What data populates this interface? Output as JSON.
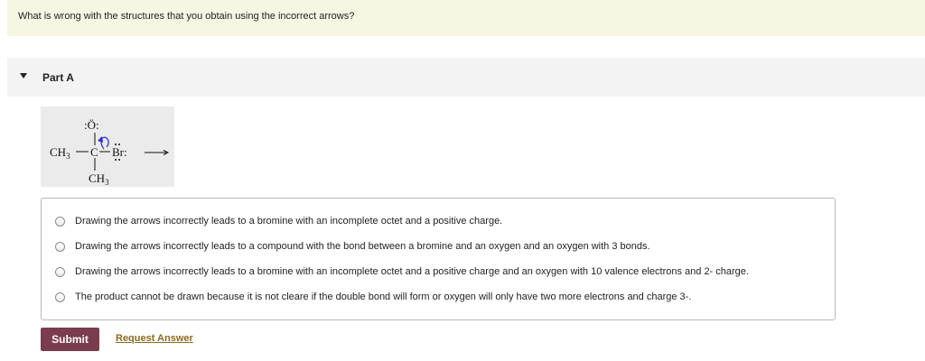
{
  "question": {
    "text": "What is wrong with the structures that you obtain using the incorrect arrows?"
  },
  "part": {
    "title": "Part A",
    "toggle_icon": "caret-down-icon"
  },
  "structure": {
    "oxygen": ":Ö:",
    "left_group": "CH",
    "left_sub": "3",
    "carbon": "C",
    "bromine": "Br:",
    "bottom_group": "CH",
    "bottom_sub": "3",
    "curved_arrow_color": "#2a2ad6",
    "reaction_arrow_icon": "right-arrow-icon"
  },
  "options": [
    {
      "label": "Drawing the arrows incorrectly leads to a bromine with an incomplete octet and a positive charge.",
      "selected": false
    },
    {
      "label": "Drawing the arrows incorrectly leads to a compound with the bond between a bromine and an oxygen and an oxygen with 3 bonds.",
      "selected": false
    },
    {
      "label": "Drawing the arrows incorrectly leads to a bromine with an incomplete octet and a positive charge and an oxygen with 10 valence electrons and 2- charge.",
      "selected": false
    },
    {
      "label": "The product cannot be drawn because it is not cleare if the double bond will form or oxygen will only have two more electrons and charge 3-.",
      "selected": false
    }
  ],
  "actions": {
    "submit_label": "Submit",
    "request_answer_label": "Request Answer"
  },
  "colors": {
    "question_bg": "#f6f6e3",
    "submit_bg": "#7a3d4e",
    "link": "#8a6a22"
  }
}
